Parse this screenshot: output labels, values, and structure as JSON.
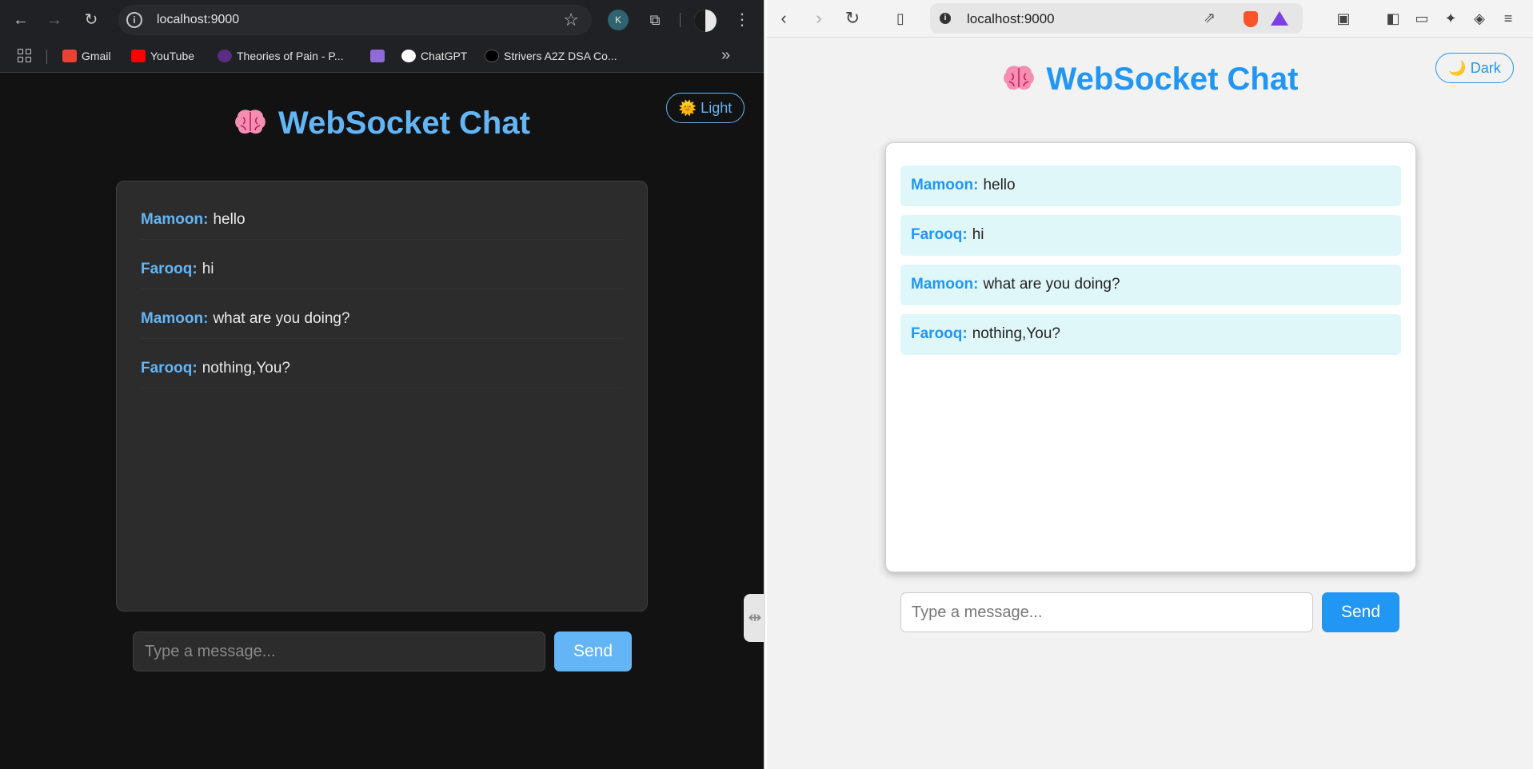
{
  "left_browser": {
    "address_bar": {
      "url": "localhost:9000"
    },
    "bookmarks": [
      {
        "label": "Gmail",
        "icon": "gmail-icon",
        "color": "#ea4335"
      },
      {
        "label": "YouTube",
        "icon": "youtube-icon",
        "color": "#ff0000"
      },
      {
        "label": "Theories of Pain - P...",
        "icon": "patreon-icon",
        "color": "#5a2d82"
      },
      {
        "label": "",
        "icon": "bookmark-icon",
        "color": "#8e6bd8"
      },
      {
        "label": "ChatGPT",
        "icon": "chatgpt-icon",
        "color": "#ffffff"
      },
      {
        "label": "Strivers A2Z DSA Co...",
        "icon": "takeuforward-icon",
        "color": "#111111"
      }
    ],
    "extension_badge": "K",
    "page": {
      "title": "WebSocket Chat",
      "theme_toggle": "🌞 Light",
      "messages": [
        {
          "user": "Mamoon:",
          "text": "hello"
        },
        {
          "user": "Farooq:",
          "text": "hi"
        },
        {
          "user": "Mamoon:",
          "text": "what are you doing?"
        },
        {
          "user": "Farooq:",
          "text": "nothing,You?"
        }
      ],
      "input_placeholder": "Type a message...",
      "send_label": "Send",
      "accent_color": "#64b5f6"
    }
  },
  "right_browser": {
    "address_bar": {
      "url": "localhost:9000"
    },
    "page": {
      "title": "WebSocket Chat",
      "theme_toggle": "🌙 Dark",
      "messages": [
        {
          "user": "Mamoon:",
          "text": "hello"
        },
        {
          "user": "Farooq:",
          "text": "hi"
        },
        {
          "user": "Mamoon:",
          "text": "what are you doing?"
        },
        {
          "user": "Farooq:",
          "text": "nothing,You?"
        }
      ],
      "input_placeholder": "Type a message...",
      "send_label": "Send",
      "accent_color": "#2196f3"
    }
  }
}
